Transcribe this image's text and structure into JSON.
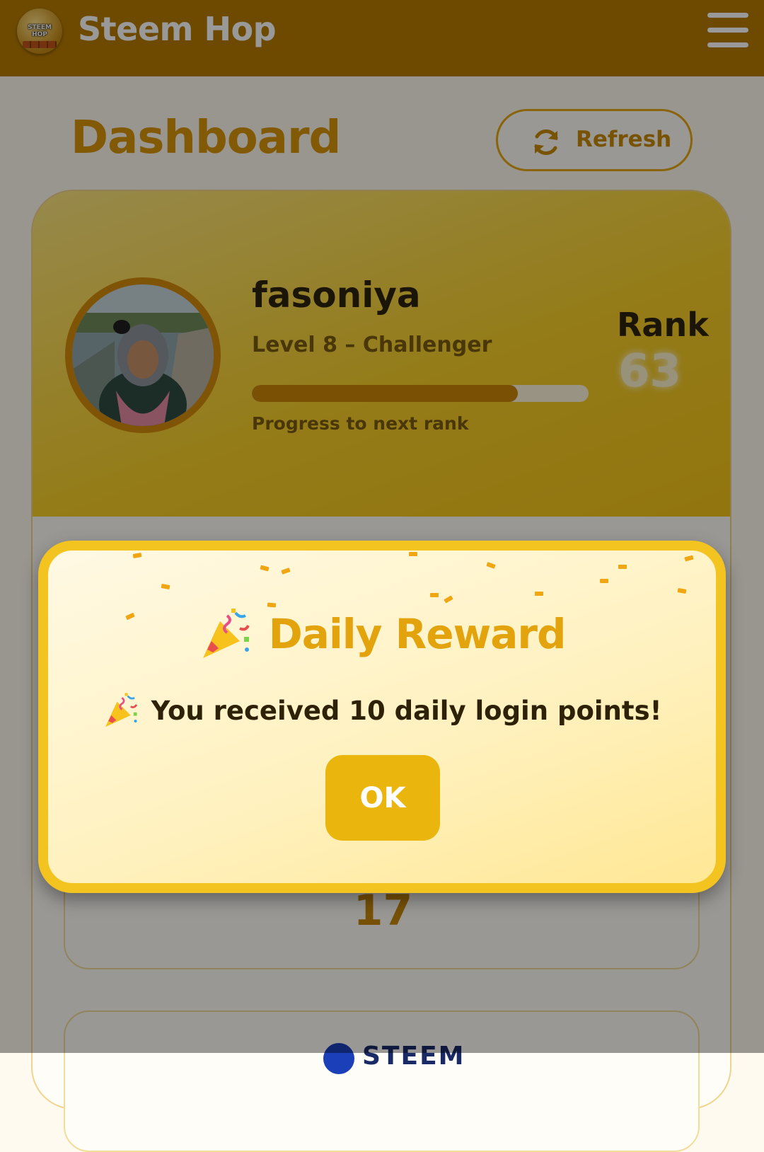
{
  "header": {
    "logo_text": "STEEM HOP",
    "app_title": "Steem Hop"
  },
  "page": {
    "title": "Dashboard",
    "refresh_label": "Refresh"
  },
  "profile": {
    "username": "fasoniya",
    "level_text": "Level 8 – Challenger",
    "progress_fraction": 0.79,
    "progress_label": "Progress to next rank",
    "rank_label": "Rank",
    "rank_value": "63"
  },
  "stats": {
    "partial_value": "17",
    "steem_label": "STEEM"
  },
  "modal": {
    "title": "Daily Reward",
    "message": "You received 10 daily login points!",
    "ok_label": "OK",
    "icon": "party-popper-icon"
  },
  "colors": {
    "header_bg": "#b87c00",
    "accent": "#e3a30c",
    "card_gradient_end": "#f4c317",
    "ok_button": "#eab50d",
    "modal_border": "#f3c41f"
  }
}
